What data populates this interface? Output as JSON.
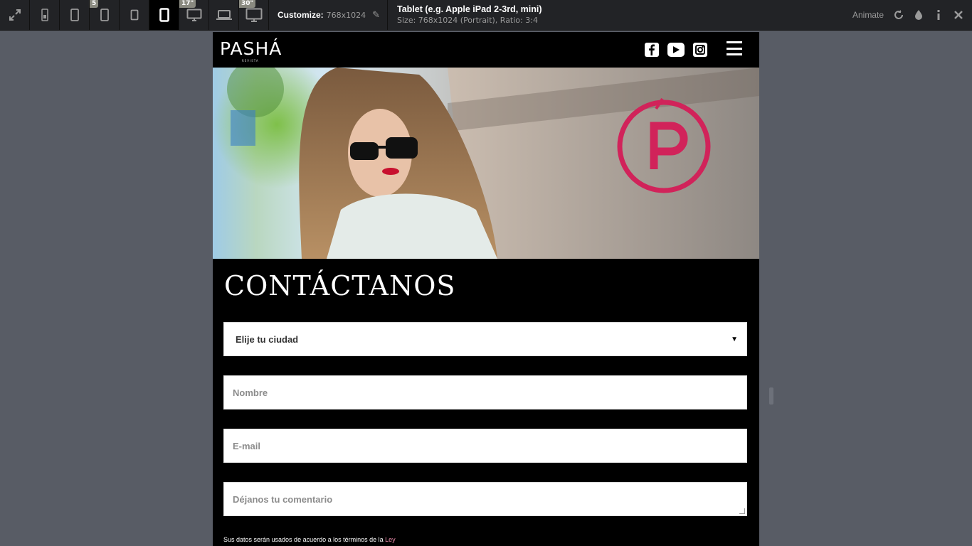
{
  "toolbar": {
    "badges": {
      "phone_large": "5",
      "desktop_small": "17\"",
      "desktop_large": "30\""
    },
    "customize_label": "Customize:",
    "customize_value": "768x1024",
    "device_name": "Tablet (e.g. Apple iPad 2-3rd, mini)",
    "device_size": "Size: 768x1024 (Portrait), Ratio: 3:4",
    "animate_label": "Animate"
  },
  "site": {
    "logo": "PASHÁ",
    "logo_sub": "REVISTA",
    "social_icons": [
      "facebook-icon",
      "youtube-icon",
      "instagram-icon"
    ],
    "accent_color": "#d1235a"
  },
  "contact": {
    "title": "CONTÁCTANOS",
    "city_select": "Elije tu ciudad",
    "name_placeholder": "Nombre",
    "email_placeholder": "E-mail",
    "comment_placeholder": "Déjanos tu comentario",
    "legal_text": "Sus datos serán usados de acuerdo a los términos de la",
    "legal_link": "Ley"
  }
}
